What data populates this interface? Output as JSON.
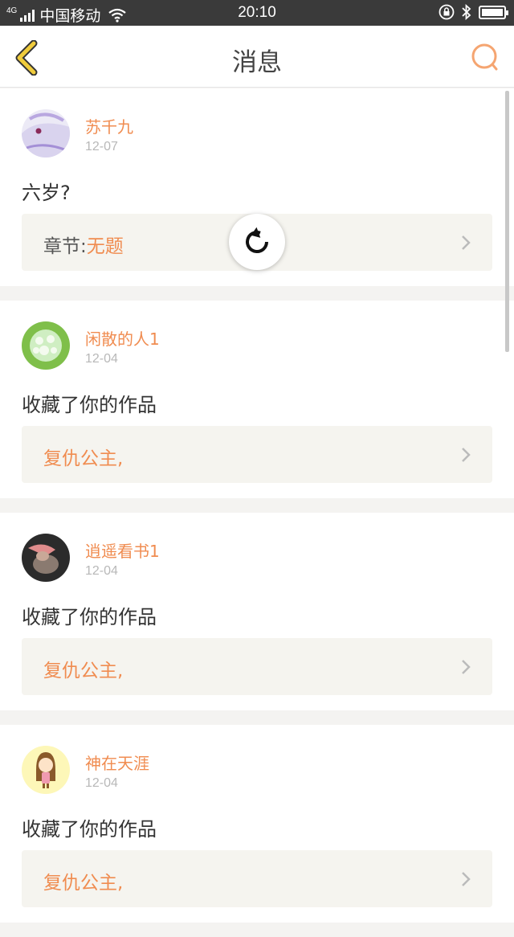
{
  "status_bar": {
    "network": "4G",
    "carrier": "中国移动",
    "time": "20:10",
    "icons": [
      "signal-icon",
      "wifi-icon",
      "rotation-lock-icon",
      "bluetooth-icon",
      "battery-icon"
    ],
    "battery_level": 1.0
  },
  "header": {
    "title": "消息",
    "back_icon": "chevron-left-icon",
    "search_icon": "search-icon",
    "accent_color": "#f0cc3c",
    "search_color": "#f5a571"
  },
  "messages": [
    {
      "user": "苏千九",
      "date": "12-07",
      "text": "六岁?",
      "ref_label": "章节:",
      "ref_value": "无题"
    },
    {
      "user": "闲散的人1",
      "date": "12-04",
      "text": "收藏了你的作品",
      "ref_value": "复仇公主,"
    },
    {
      "user": "逍遥看书1",
      "date": "12-04",
      "text": "收藏了你的作品",
      "ref_value": "复仇公主,"
    },
    {
      "user": "神在天涯",
      "date": "12-04",
      "text": "收藏了你的作品",
      "ref_value": "复仇公主,"
    }
  ],
  "colors": {
    "username": "#f08c50",
    "ref_bg": "#f5f4ef",
    "page_bg": "#f4f3f1"
  },
  "overlay": {
    "icon": "refresh-icon"
  }
}
